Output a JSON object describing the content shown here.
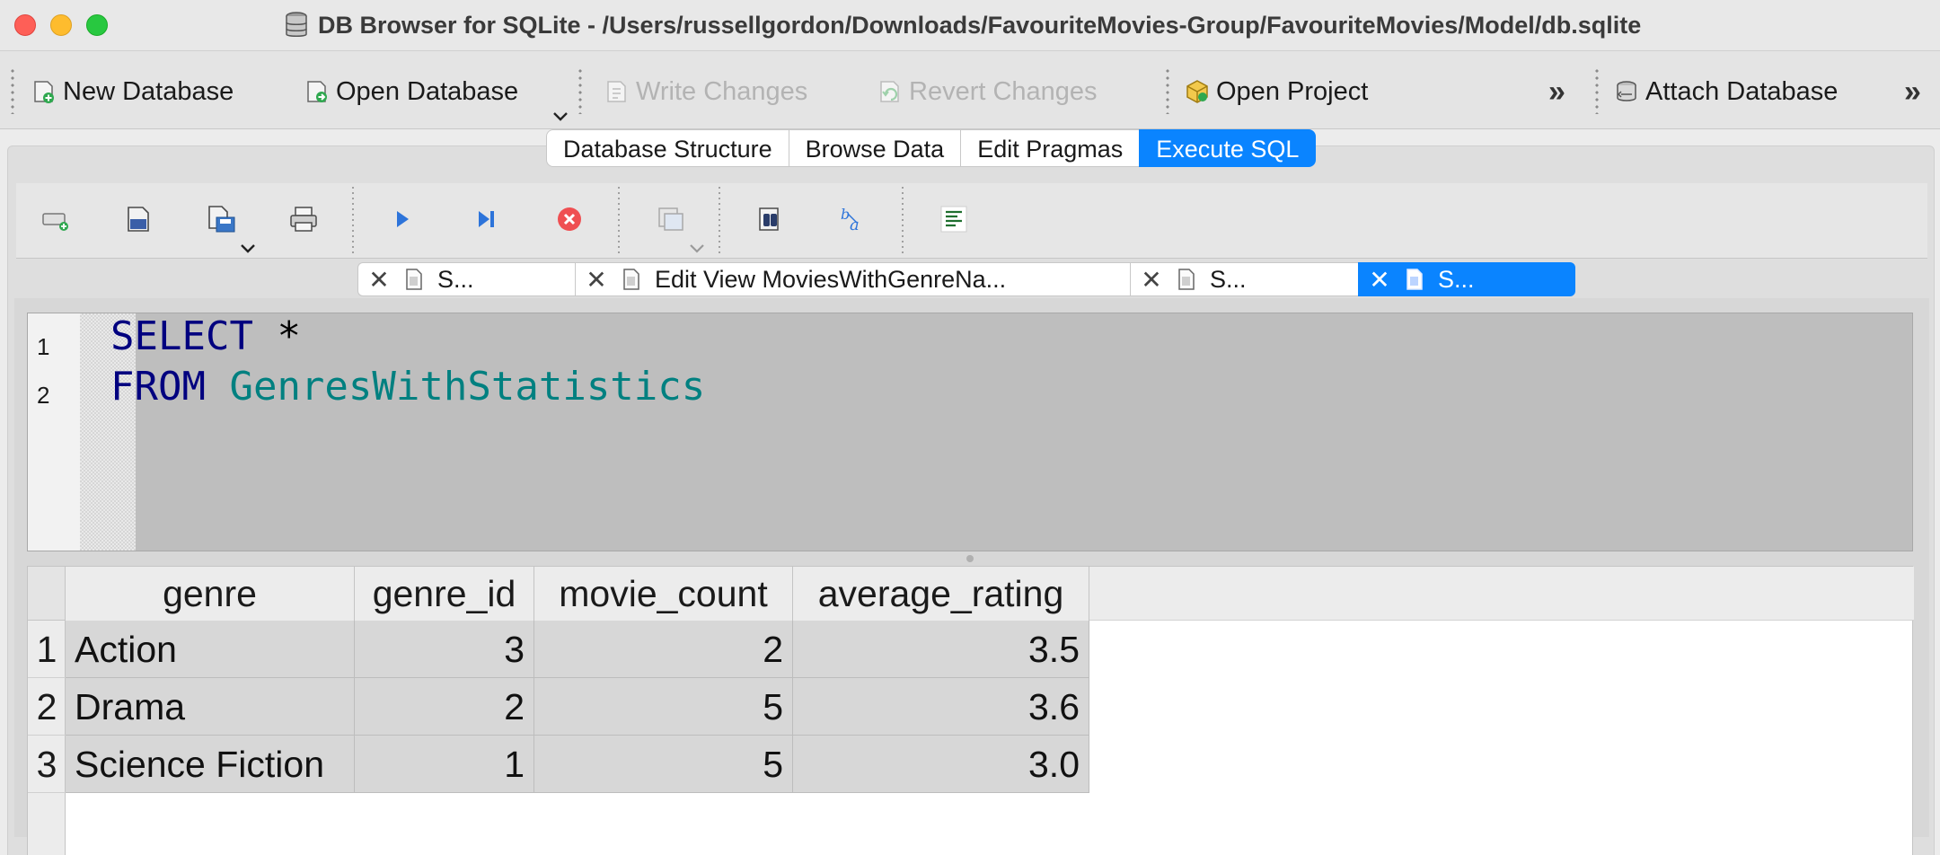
{
  "window": {
    "title": "DB Browser for SQLite - /Users/russellgordon/Downloads/FavouriteMovies-Group/FavouriteMovies/Model/db.sqlite"
  },
  "toolbar": {
    "new_database": "New Database",
    "open_database": "Open Database",
    "write_changes": "Write Changes",
    "revert_changes": "Revert Changes",
    "open_project": "Open Project",
    "attach_database": "Attach Database",
    "overflow_glyph": "»"
  },
  "main_tabs": [
    {
      "label": "Database Structure",
      "active": false
    },
    {
      "label": "Browse Data",
      "active": false
    },
    {
      "label": "Edit Pragmas",
      "active": false
    },
    {
      "label": "Execute SQL",
      "active": true
    }
  ],
  "editor_tabs": [
    {
      "label": "S...",
      "active": false
    },
    {
      "label": "Edit View MoviesWithGenreNa...",
      "active": false
    },
    {
      "label": "S...",
      "active": false
    },
    {
      "label": "S...",
      "active": true
    }
  ],
  "editor": {
    "line_numbers": [
      "1",
      "2"
    ],
    "line1_keyword": "SELECT",
    "line1_rest": " *",
    "line2_keyword": "FROM",
    "line2_ident": " GenresWithStatistics"
  },
  "results": {
    "columns": [
      "genre",
      "genre_id",
      "movie_count",
      "average_rating"
    ],
    "row_numbers": [
      "1",
      "2",
      "3"
    ],
    "rows": [
      [
        "Action",
        "3",
        "2",
        "3.5"
      ],
      [
        "Drama",
        "2",
        "5",
        "3.6"
      ],
      [
        "Science Fiction",
        "1",
        "5",
        "3.0"
      ]
    ]
  },
  "colors": {
    "accent": "#0a84ff",
    "keyword": "#00007f",
    "identifier": "#008080",
    "close": "#fe5f57",
    "minimize": "#febc2e",
    "maximize": "#28c840"
  }
}
